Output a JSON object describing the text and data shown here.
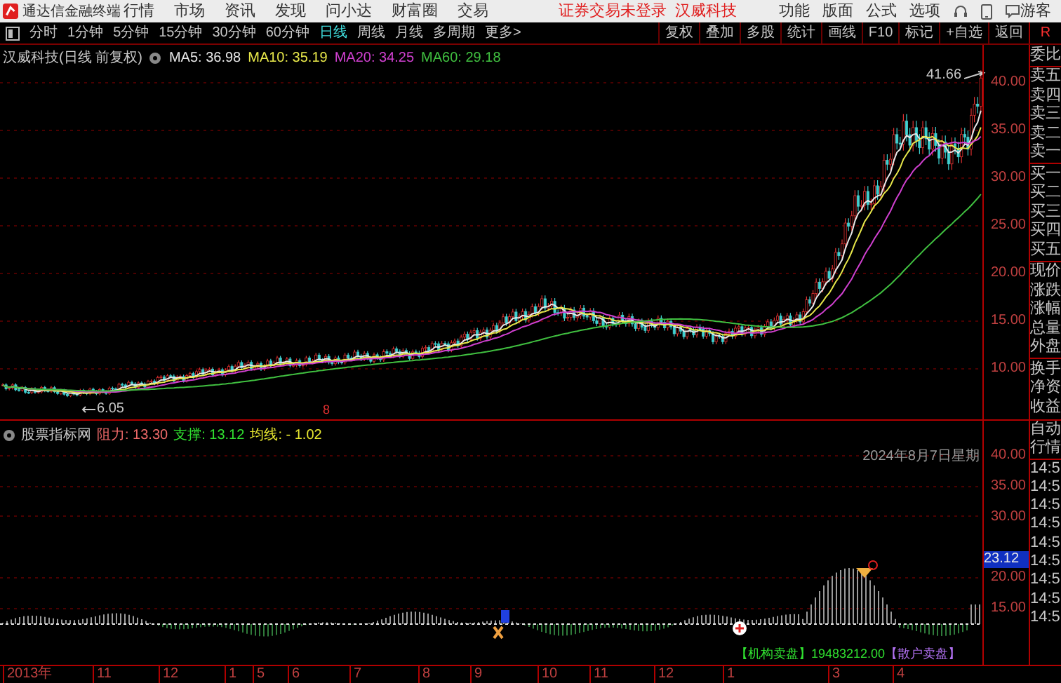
{
  "menubar": {
    "app_title": "通达信金融终端",
    "menus": [
      "行情",
      "市场",
      "资讯",
      "发现",
      "问小达",
      "财富圈",
      "交易"
    ],
    "notice": "证券交易未登录",
    "stock_link": "汉威科技",
    "tools": [
      "功能",
      "版面",
      "公式",
      "选项"
    ],
    "user": "游客"
  },
  "toolbar": {
    "periods": [
      {
        "label": "分时",
        "selected": false
      },
      {
        "label": "1分钟",
        "selected": false
      },
      {
        "label": "5分钟",
        "selected": false
      },
      {
        "label": "15分钟",
        "selected": false
      },
      {
        "label": "30分钟",
        "selected": false
      },
      {
        "label": "60分钟",
        "selected": false
      },
      {
        "label": "日线",
        "selected": true
      },
      {
        "label": "周线",
        "selected": false
      },
      {
        "label": "月线",
        "selected": false
      },
      {
        "label": "多周期",
        "selected": false
      },
      {
        "label": "更多>",
        "selected": false
      }
    ],
    "actions": [
      "复权",
      "叠加",
      "多股",
      "统计",
      "画线",
      "F10",
      "标记",
      "+自选",
      "返回"
    ],
    "corner": "R"
  },
  "price_pane": {
    "title": "汉威科技(日线 前复权)",
    "indicators": [
      {
        "label": "MA5: 36.98",
        "color": "#e8e8e8"
      },
      {
        "label": "MA10: 35.19",
        "color": "#e8e84a"
      },
      {
        "label": "MA20: 34.25",
        "color": "#d040d0"
      },
      {
        "label": "MA60: 29.18",
        "color": "#40c040"
      }
    ],
    "high_label": "41.66",
    "low_label": "6.05",
    "marker": "8",
    "axis_labels": [
      "40.00",
      "35.00",
      "30.00",
      "25.00",
      "20.00",
      "15.00",
      "10.00"
    ],
    "quote_groups": [
      [
        "委比"
      ],
      [
        "卖五",
        "卖四",
        "卖三",
        "卖二",
        "卖一"
      ],
      [
        "买一",
        "买二",
        "买三",
        "买四",
        "买五"
      ],
      [
        "现价",
        "涨跌",
        "涨幅",
        "总量",
        "外盘"
      ],
      [
        "换手",
        "净资",
        "收益"
      ]
    ]
  },
  "indicator_pane": {
    "name": "股票指标网",
    "values": [
      {
        "label": "阻力: 13.30",
        "color": "#f06a6a"
      },
      {
        "label": "支撑: 13.12",
        "color": "#30e030"
      },
      {
        "label": "均线: - 1.02",
        "color": "#e8e830"
      }
    ],
    "date_label": "2024年8月7日星期",
    "axis_labels": [
      {
        "text": "40.00",
        "kind": "tick"
      },
      {
        "text": "35.00",
        "kind": "tick"
      },
      {
        "text": "30.00",
        "kind": "tick"
      },
      {
        "text": "23.12",
        "kind": "current"
      },
      {
        "text": "20.00",
        "kind": "tick"
      },
      {
        "text": "15.00",
        "kind": "tick"
      }
    ],
    "side_labels": [
      "自动",
      "行情",
      "14:5",
      "14:5",
      "14:5",
      "14:5",
      "14:5",
      "14:5",
      "14:5",
      "14:5",
      "14:5"
    ],
    "legend": [
      {
        "label": "【机构卖盘】",
        "color": "#30e030"
      },
      {
        "label": "19483212.00",
        "color": "#30e030"
      },
      {
        "label": "【散户卖盘】",
        "color": "#b070f0"
      }
    ]
  },
  "time_axis": [
    "2013年",
    "11",
    "12",
    "1",
    "5",
    "6",
    "7",
    "8",
    "9",
    "10",
    "11",
    "12",
    "1",
    "3",
    "4"
  ]
}
